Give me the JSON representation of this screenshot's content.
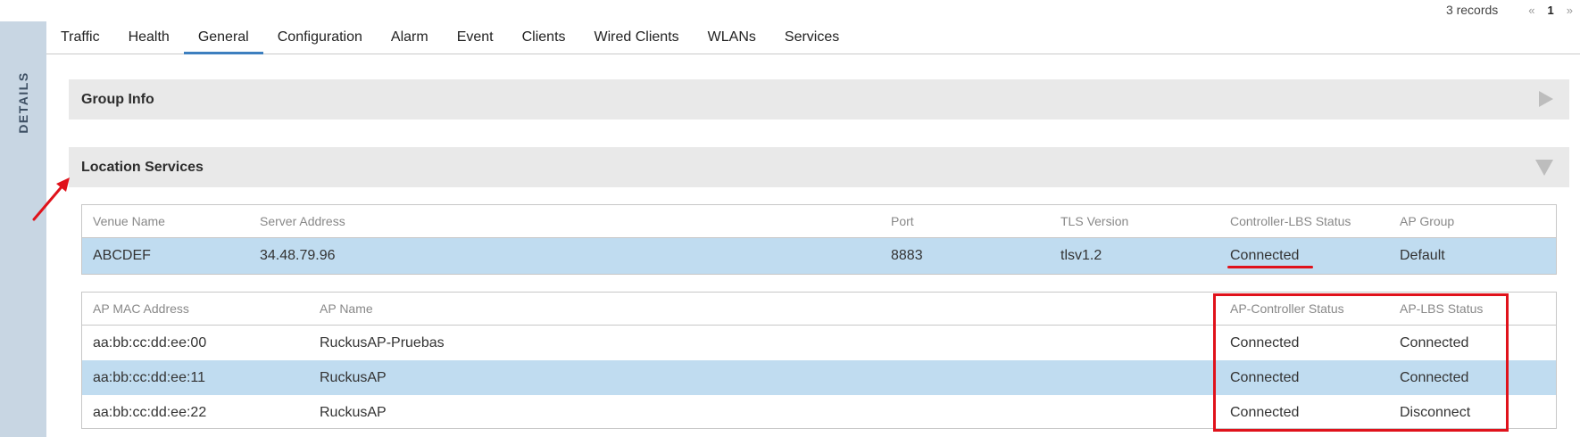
{
  "side": {
    "label": "DETAILS"
  },
  "pager": {
    "records": "3 records",
    "first": "«",
    "page": "1",
    "last": "»"
  },
  "tabs": [
    {
      "label": "Traffic"
    },
    {
      "label": "Health"
    },
    {
      "label": "General"
    },
    {
      "label": "Configuration"
    },
    {
      "label": "Alarm"
    },
    {
      "label": "Event"
    },
    {
      "label": "Clients"
    },
    {
      "label": "Wired Clients"
    },
    {
      "label": "WLANs"
    },
    {
      "label": "Services"
    }
  ],
  "active_tab": "General",
  "sections": {
    "group_info": {
      "title": "Group Info"
    },
    "location_services": {
      "title": "Location Services"
    }
  },
  "venue_table": {
    "headers": {
      "venue_name": "Venue Name",
      "server_address": "Server Address",
      "port": "Port",
      "tls_version": "TLS Version",
      "controller_lbs_status": "Controller-LBS Status",
      "ap_group": "AP Group"
    },
    "rows": [
      {
        "venue_name": "ABCDEF",
        "server_address": "34.48.79.96",
        "port": "8883",
        "tls_version": "tlsv1.2",
        "controller_lbs_status": "Connected",
        "ap_group": "Default"
      }
    ]
  },
  "ap_table": {
    "headers": {
      "ap_mac": "AP MAC Address",
      "ap_name": "AP Name",
      "ap_controller_status": "AP-Controller Status",
      "ap_lbs_status": "AP-LBS Status"
    },
    "rows": [
      {
        "ap_mac": "aa:bb:cc:dd:ee:00",
        "ap_name": "RuckusAP-Pruebas",
        "ap_controller_status": "Connected",
        "ap_lbs_status": "Connected"
      },
      {
        "ap_mac": "aa:bb:cc:dd:ee:11",
        "ap_name": "RuckusAP",
        "ap_controller_status": "Connected",
        "ap_lbs_status": "Connected"
      },
      {
        "ap_mac": "aa:bb:cc:dd:ee:22",
        "ap_name": "RuckusAP",
        "ap_controller_status": "Connected",
        "ap_lbs_status": "Disconnect"
      }
    ]
  },
  "colors": {
    "highlight_row": "#c0dcf0",
    "active_tab_underline": "#3d7fbf",
    "annotation_red": "#e0121b",
    "side_strip": "#c8d6e3"
  }
}
